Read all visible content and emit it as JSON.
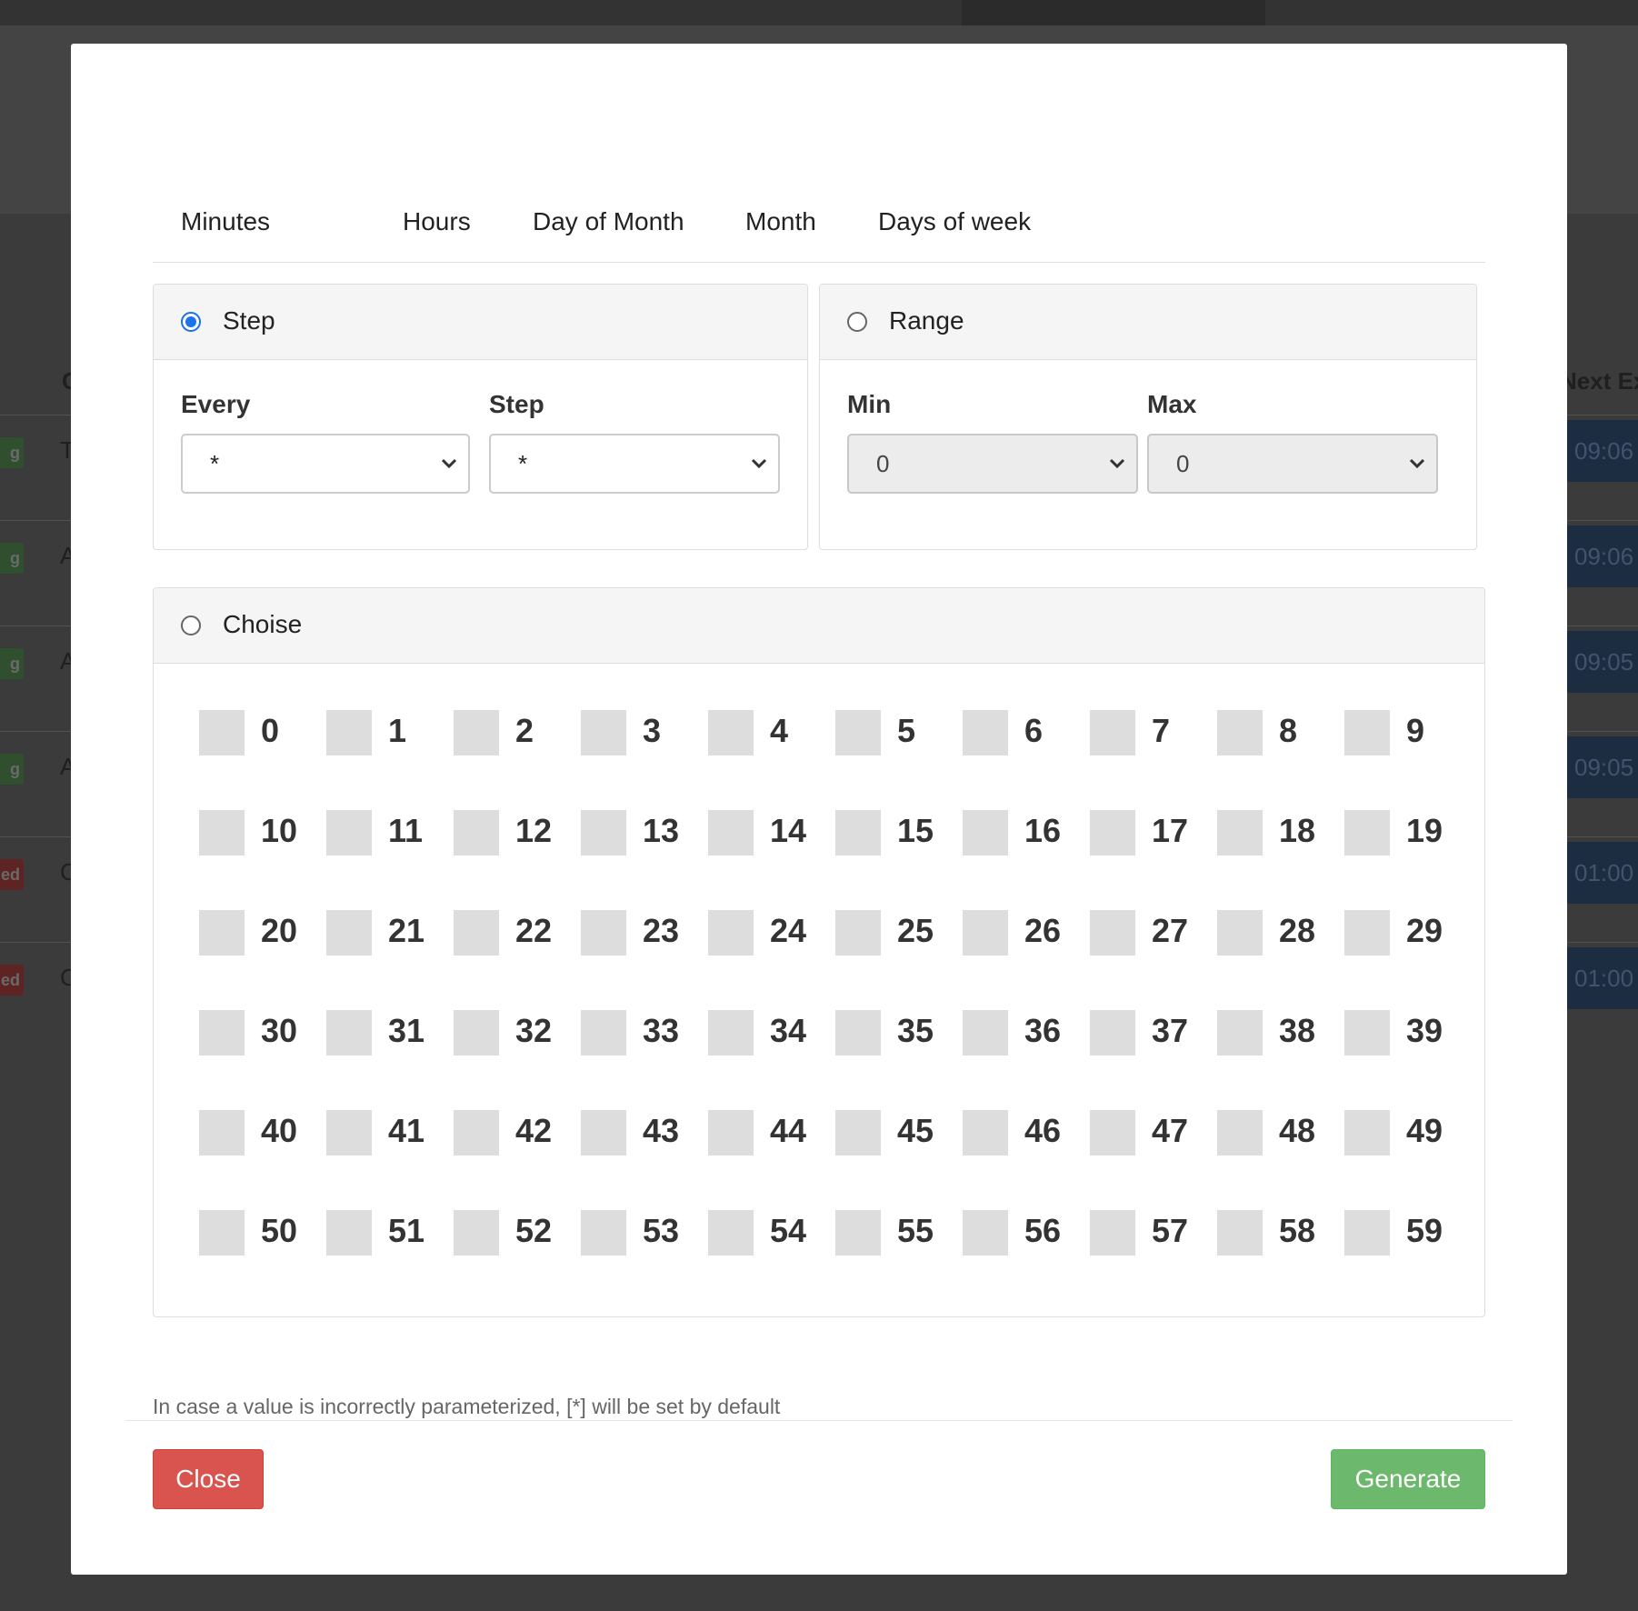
{
  "background": {
    "header_left": "C",
    "header_right": "Next Ex",
    "rows": [
      {
        "badge": "g",
        "badge_color": "green",
        "letter": "T",
        "time": "09:06"
      },
      {
        "badge": "g",
        "badge_color": "green",
        "letter": "A",
        "time": "09:06"
      },
      {
        "badge": "g",
        "badge_color": "green",
        "letter": "A",
        "time": "09:05"
      },
      {
        "badge": "g",
        "badge_color": "green",
        "letter": "A",
        "time": "09:05"
      },
      {
        "badge": "ed",
        "badge_color": "red",
        "letter": "C",
        "time": "01:00"
      },
      {
        "badge": "ed",
        "badge_color": "red",
        "letter": "C",
        "time": "01:00"
      }
    ]
  },
  "tabs": [
    "Minutes",
    "Hours",
    "Day of Month",
    "Month",
    "Days of week"
  ],
  "step_panel": {
    "title": "Step",
    "checked": true,
    "every_label": "Every",
    "every_value": "*",
    "step_label": "Step",
    "step_value": "*"
  },
  "range_panel": {
    "title": "Range",
    "checked": false,
    "min_label": "Min",
    "min_value": "0",
    "max_label": "Max",
    "max_value": "0"
  },
  "choice_panel": {
    "title": "Choise",
    "checked": false,
    "values": [
      "0",
      "1",
      "2",
      "3",
      "4",
      "5",
      "6",
      "7",
      "8",
      "9",
      "10",
      "11",
      "12",
      "13",
      "14",
      "15",
      "16",
      "17",
      "18",
      "19",
      "20",
      "21",
      "22",
      "23",
      "24",
      "25",
      "26",
      "27",
      "28",
      "29",
      "30",
      "31",
      "32",
      "33",
      "34",
      "35",
      "36",
      "37",
      "38",
      "39",
      "40",
      "41",
      "42",
      "43",
      "44",
      "45",
      "46",
      "47",
      "48",
      "49",
      "50",
      "51",
      "52",
      "53",
      "54",
      "55",
      "56",
      "57",
      "58",
      "59"
    ]
  },
  "hint": "In case a value is incorrectly parameterized, [*] will be set by default",
  "buttons": {
    "close": "Close",
    "generate": "Generate"
  },
  "colors": {
    "radio_accent": "#1a73e8",
    "close_button": "#d9534f",
    "generate_button": "#6cb86c"
  }
}
